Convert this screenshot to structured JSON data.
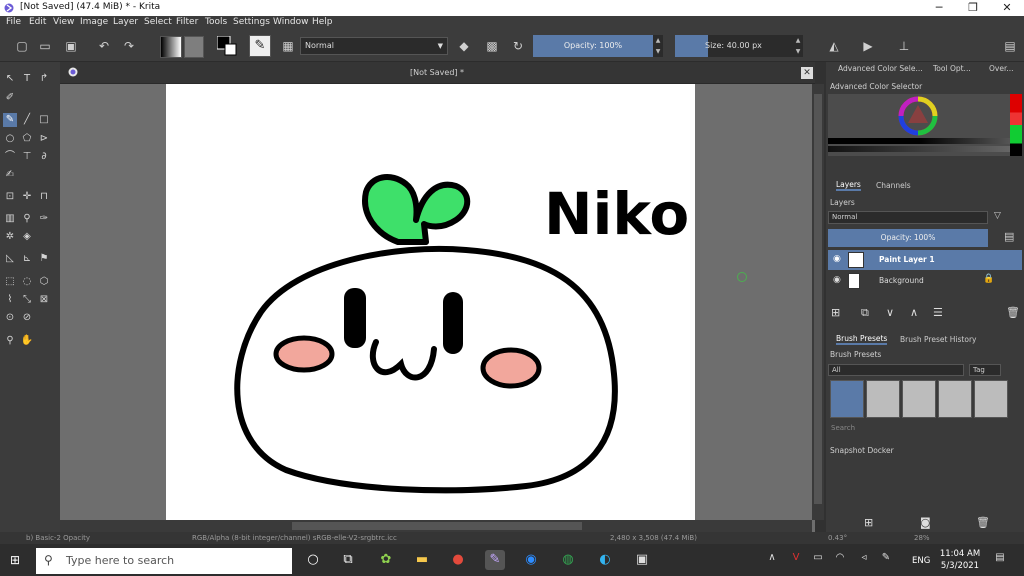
{
  "window": {
    "title": "[Not Saved]  (47.4 MiB)  * - Krita",
    "minimize": "─",
    "maximize": "❐",
    "close": "✕"
  },
  "menus": [
    "File",
    "Edit",
    "View",
    "Image",
    "Layer",
    "Select",
    "Filter",
    "Tools",
    "Settings",
    "Window",
    "Help"
  ],
  "toolbar": {
    "blend_mode": "Normal",
    "opacity": "Opacity: 100%",
    "size": "Size: 40.00 px"
  },
  "document": {
    "tab_title": "[Not Saved]  *",
    "close": "✕",
    "signature": "Niko"
  },
  "dockers": {
    "tabs": [
      "Advanced Color Sele...",
      "Tool Opt...",
      "Over..."
    ],
    "color_selector": "Advanced Color Selector",
    "layer_tabs": [
      "Layers",
      "Channels"
    ],
    "layers_title": "Layers",
    "layer_blend": "Normal",
    "layer_opacity": "Opacity:  100%",
    "layers": [
      {
        "name": "Paint Layer 1",
        "selected": true
      },
      {
        "name": "Background",
        "selected": false
      }
    ],
    "preset_tabs": [
      "Brush Presets",
      "Brush Preset History"
    ],
    "presets_title": "Brush Presets",
    "preset_filter": "All",
    "tag_label": "Tag",
    "search_placeholder": "Search",
    "snapshot_title": "Snapshot Docker"
  },
  "status": {
    "brush": "b) Basic-2 Opacity",
    "color_space": "RGB/Alpha (8-bit integer/channel)  sRGB-elle-V2-srgbtrc.icc",
    "dimensions": "2,480 x 3,508 (47.4 MiB)",
    "rotation": "0.43°",
    "zoom": "28%"
  },
  "taskbar": {
    "search_placeholder": "Type here to search",
    "time": "11:04 AM",
    "date": "5/3/2021",
    "lang": "ENG"
  },
  "colors": {
    "accent": "#5a7aa8",
    "panel": "#3a3a3a",
    "sprout": "#3ee06a",
    "blush": "#f2a79c"
  }
}
